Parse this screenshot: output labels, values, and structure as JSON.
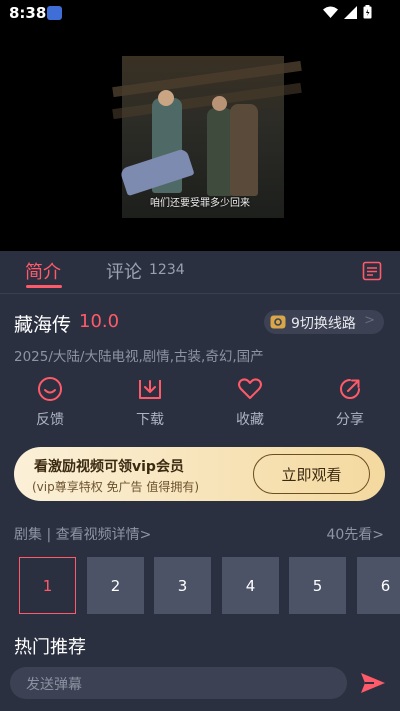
{
  "status": {
    "time": "8:38"
  },
  "video": {
    "subtitle": "咱们还要受罪多少回来"
  },
  "tabs": {
    "intro": "简介",
    "comments": "评论",
    "comment_count": "1234"
  },
  "show": {
    "title": "藏海传",
    "score": "10.0",
    "route_button": "9切换线路",
    "tags": "2025/大陆/大陆电视,剧情,古装,奇幻,国产"
  },
  "actions": {
    "feedback": "反馈",
    "download": "下载",
    "favorite": "收藏",
    "share": "分享"
  },
  "vip": {
    "title": "看激励视频可领vip会员",
    "subtitle": "(vip尊享特权 免广告 值得拥有)",
    "button": "立即观看"
  },
  "episodes": {
    "header": "剧集 | 查看视频详情>",
    "preview": "40先看>",
    "items": [
      "1",
      "2",
      "3",
      "4",
      "5",
      "6"
    ]
  },
  "hot": {
    "title": "热门推荐"
  },
  "danmu": {
    "placeholder": "发送弹幕"
  },
  "colors": {
    "accent": "#ff5a6a",
    "background": "#2b3040",
    "vip_gold": "#f4d99f"
  }
}
